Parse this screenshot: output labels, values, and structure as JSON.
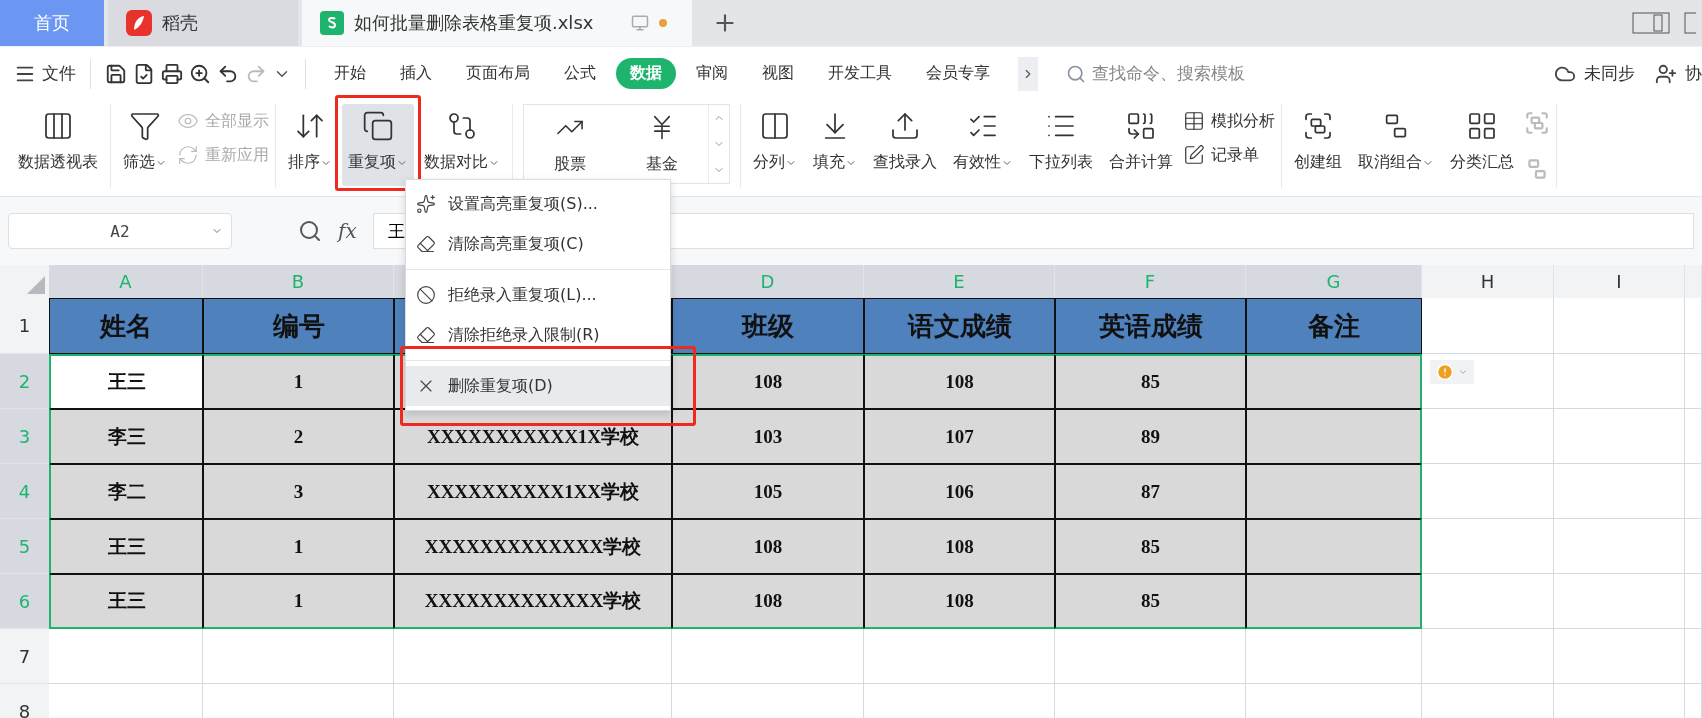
{
  "tabs": [
    {
      "label": "首页",
      "kind": "home",
      "selected": false
    },
    {
      "label": "稻壳",
      "kind": "app",
      "selected": false
    },
    {
      "label": "如何批量删除表格重复项.xlsx",
      "kind": "document",
      "selected": true,
      "unsaved": true
    }
  ],
  "menu": {
    "file": "文件",
    "tabs": [
      {
        "label": "开始",
        "selected": false
      },
      {
        "label": "插入",
        "selected": false
      },
      {
        "label": "页面布局",
        "selected": false
      },
      {
        "label": "公式",
        "selected": false
      },
      {
        "label": "数据",
        "selected": true
      },
      {
        "label": "审阅",
        "selected": false
      },
      {
        "label": "视图",
        "selected": false
      },
      {
        "label": "开发工具",
        "selected": false
      },
      {
        "label": "会员专享",
        "selected": false
      }
    ],
    "search": {
      "placeholder": "查找命令、搜索模板"
    },
    "sync": "未同步",
    "collab": "协"
  },
  "ribbon": [
    {
      "items": [
        {
          "kind": "large",
          "label": "数据透视表",
          "caret": false,
          "pressed": false,
          "annotated": false
        }
      ]
    },
    {
      "items": [
        {
          "kind": "large",
          "label": "筛选",
          "caret": true,
          "pressed": false,
          "annotated": false
        },
        {
          "kind": "stack",
          "rows": [
            {
              "label": "全部显示",
              "disabled": true
            },
            {
              "label": "重新应用",
              "disabled": true
            }
          ]
        }
      ]
    },
    {
      "items": [
        {
          "kind": "large",
          "label": "排序",
          "caret": true,
          "pressed": false,
          "annotated": false
        },
        {
          "kind": "large",
          "label": "重复项",
          "caret": true,
          "pressed": true,
          "annotated": true
        },
        {
          "kind": "large",
          "label": "数据对比",
          "caret": true,
          "pressed": false,
          "annotated": false
        }
      ]
    },
    {
      "items": [
        {
          "kind": "gallery",
          "entries": [
            "股票",
            "基金"
          ]
        }
      ]
    },
    {
      "items": [
        {
          "kind": "large",
          "label": "分列",
          "caret": true,
          "pressed": false,
          "annotated": false
        },
        {
          "kind": "large",
          "label": "填充",
          "caret": true,
          "pressed": false,
          "annotated": false
        },
        {
          "kind": "large",
          "label": "查找录入",
          "caret": false,
          "pressed": false,
          "annotated": false
        },
        {
          "kind": "large",
          "label": "有效性",
          "caret": true,
          "pressed": false,
          "annotated": false
        },
        {
          "kind": "large",
          "label": "下拉列表",
          "caret": false,
          "pressed": false,
          "annotated": false
        },
        {
          "kind": "large",
          "label": "合并计算",
          "caret": false,
          "pressed": false,
          "annotated": false
        },
        {
          "kind": "stack",
          "rows": [
            {
              "label": "模拟分析",
              "disabled": false
            },
            {
              "label": "记录单",
              "disabled": false
            }
          ]
        }
      ]
    },
    {
      "items": [
        {
          "kind": "large",
          "label": "创建组",
          "caret": false,
          "pressed": false,
          "annotated": false
        },
        {
          "kind": "large",
          "label": "取消组合",
          "caret": true,
          "pressed": false,
          "annotated": false
        },
        {
          "kind": "large",
          "label": "分类汇总",
          "caret": false,
          "pressed": false,
          "annotated": false
        },
        {
          "kind": "cut"
        }
      ]
    }
  ],
  "dropdown": {
    "groups": [
      [
        {
          "label": "设置高亮重复项(S)...",
          "hovered": false,
          "annotated": false
        },
        {
          "label": "清除高亮重复项(C)",
          "hovered": false,
          "annotated": false
        }
      ],
      [
        {
          "label": "拒绝录入重复项(L)...",
          "hovered": false,
          "annotated": false
        },
        {
          "label": "清除拒绝录入限制(R)",
          "hovered": false,
          "annotated": false
        }
      ],
      [
        {
          "label": "删除重复项(D)",
          "hovered": true,
          "annotated": true
        }
      ]
    ]
  },
  "formula_bar": {
    "name_box": "A2",
    "fx": "fx",
    "value": "王"
  },
  "sheet": {
    "columns": [
      {
        "label": "A",
        "selected": true
      },
      {
        "label": "B",
        "selected": true
      },
      {
        "selected": true
      },
      {
        "label": "D",
        "selected": true
      },
      {
        "label": "E",
        "selected": true
      },
      {
        "label": "F",
        "selected": true
      },
      {
        "label": "G",
        "selected": true
      },
      {
        "label": "H",
        "selected": false
      },
      {
        "label": "I",
        "selected": false
      }
    ],
    "rows": [
      {
        "header": "1",
        "kind": "title",
        "selected": false,
        "cells": [
          {
            "text": "姓名",
            "active": false
          },
          {
            "text": "编号",
            "active": false
          },
          {
            "active": false
          },
          {
            "text": "班级",
            "active": false
          },
          {
            "text": "语文成绩",
            "active": false
          },
          {
            "text": "英语成绩",
            "active": false
          },
          {
            "text": "备注",
            "active": false
          }
        ]
      },
      {
        "header": "2",
        "kind": "data",
        "selected": true,
        "warning": true,
        "cells": [
          {
            "text": "王三",
            "active": true
          },
          {
            "text": "1",
            "active": false
          },
          {
            "active": false
          },
          {
            "text": "108",
            "active": false
          },
          {
            "text": "108",
            "active": false
          },
          {
            "text": "85",
            "active": false
          },
          {
            "active": false
          }
        ]
      },
      {
        "header": "3",
        "kind": "data",
        "selected": true,
        "cells": [
          {
            "text": "李三",
            "active": false
          },
          {
            "text": "2",
            "active": false
          },
          {
            "text": "XXXXXXXXXXX1X学校",
            "active": false
          },
          {
            "text": "103",
            "active": false
          },
          {
            "text": "107",
            "active": false
          },
          {
            "text": "89",
            "active": false
          },
          {
            "active": false
          }
        ]
      },
      {
        "header": "4",
        "kind": "data",
        "selected": true,
        "cells": [
          {
            "text": "李二",
            "active": false
          },
          {
            "text": "3",
            "active": false
          },
          {
            "text": "XXXXXXXXXX1XX学校",
            "active": false
          },
          {
            "text": "105",
            "active": false
          },
          {
            "text": "106",
            "active": false
          },
          {
            "text": "87",
            "active": false
          },
          {
            "active": false
          }
        ]
      },
      {
        "header": "5",
        "kind": "data",
        "selected": true,
        "cells": [
          {
            "text": "王三",
            "active": false
          },
          {
            "text": "1",
            "active": false
          },
          {
            "text": "XXXXXXXXXXXXX学校",
            "active": false
          },
          {
            "text": "108",
            "active": false
          },
          {
            "text": "108",
            "active": false
          },
          {
            "text": "85",
            "active": false
          },
          {
            "active": false
          }
        ]
      },
      {
        "header": "6",
        "kind": "data",
        "selected": true,
        "cells": [
          {
            "text": "王三",
            "active": false
          },
          {
            "text": "1",
            "active": false
          },
          {
            "text": "XXXXXXXXXXXXX学校",
            "active": false
          },
          {
            "text": "108",
            "active": false
          },
          {
            "text": "108",
            "active": false
          },
          {
            "text": "85",
            "active": false
          },
          {
            "active": false
          }
        ]
      },
      {
        "header": "7",
        "selected": false
      },
      {
        "header": "8",
        "selected": false
      }
    ]
  }
}
